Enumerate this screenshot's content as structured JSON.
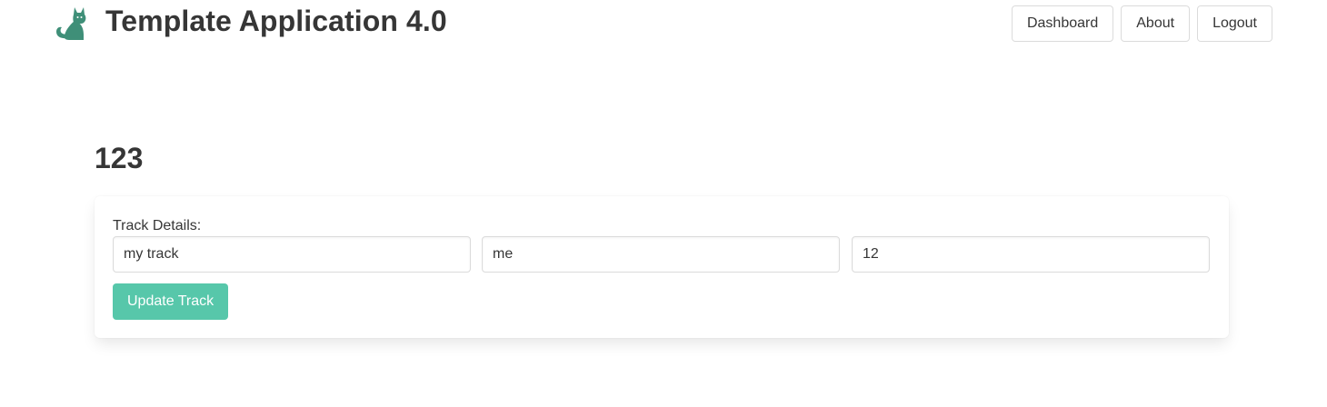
{
  "header": {
    "logo_icon": "cat-icon",
    "logo_color": "#3f8f78",
    "title": "Template Application 4.0",
    "nav": {
      "dashboard_label": "Dashboard",
      "about_label": "About",
      "logout_label": "Logout"
    }
  },
  "main": {
    "heading": "123",
    "form": {
      "label": "Track Details:",
      "fields": [
        {
          "value": "my track"
        },
        {
          "value": "me"
        },
        {
          "value": "12"
        }
      ],
      "submit_label": "Update Track",
      "submit_color": "#57c7aa"
    }
  }
}
